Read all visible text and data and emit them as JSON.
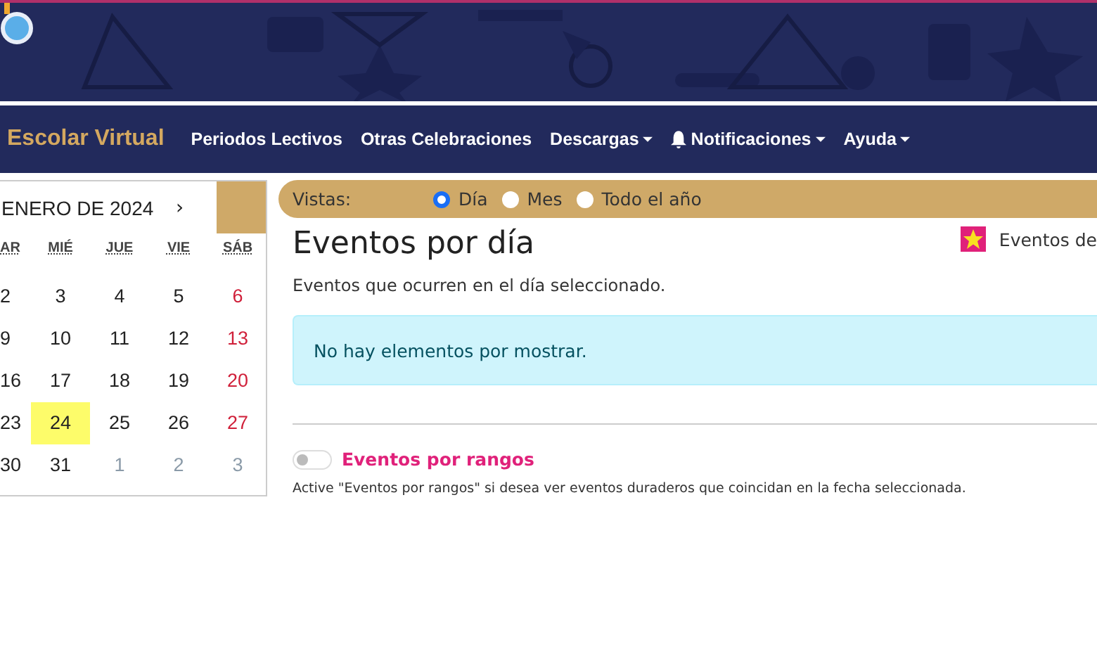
{
  "navbar": {
    "brand": "Escolar Virtual",
    "items": [
      {
        "label": "Periodos Lectivos",
        "dropdown": false,
        "bell": false
      },
      {
        "label": "Otras Celebraciones",
        "dropdown": false,
        "bell": false
      },
      {
        "label": "Descargas",
        "dropdown": true,
        "bell": false
      },
      {
        "label": "Notificaciones",
        "dropdown": true,
        "bell": true
      },
      {
        "label": "Ayuda",
        "dropdown": true,
        "bell": false
      }
    ]
  },
  "calendar": {
    "title": "ENERO DE 2024",
    "next": "›",
    "weekdays": [
      "AR",
      "MIÉ",
      "JUE",
      "VIE",
      "SÁB"
    ],
    "weeks": [
      [
        {
          "day": "2",
          "weekend": false,
          "other_month": false,
          "selected": false
        },
        {
          "day": "3",
          "weekend": false,
          "other_month": false,
          "selected": false
        },
        {
          "day": "4",
          "weekend": false,
          "other_month": false,
          "selected": false
        },
        {
          "day": "5",
          "weekend": false,
          "other_month": false,
          "selected": false
        },
        {
          "day": "6",
          "weekend": true,
          "other_month": false,
          "selected": false
        }
      ],
      [
        {
          "day": "9",
          "weekend": false,
          "other_month": false,
          "selected": false
        },
        {
          "day": "10",
          "weekend": false,
          "other_month": false,
          "selected": false
        },
        {
          "day": "11",
          "weekend": false,
          "other_month": false,
          "selected": false
        },
        {
          "day": "12",
          "weekend": false,
          "other_month": false,
          "selected": false
        },
        {
          "day": "13",
          "weekend": true,
          "other_month": false,
          "selected": false
        }
      ],
      [
        {
          "day": "16",
          "weekend": false,
          "other_month": false,
          "selected": false
        },
        {
          "day": "17",
          "weekend": false,
          "other_month": false,
          "selected": false
        },
        {
          "day": "18",
          "weekend": false,
          "other_month": false,
          "selected": false
        },
        {
          "day": "19",
          "weekend": false,
          "other_month": false,
          "selected": false
        },
        {
          "day": "20",
          "weekend": true,
          "other_month": false,
          "selected": false
        }
      ],
      [
        {
          "day": "23",
          "weekend": false,
          "other_month": false,
          "selected": false
        },
        {
          "day": "24",
          "weekend": false,
          "other_month": false,
          "selected": true
        },
        {
          "day": "25",
          "weekend": false,
          "other_month": false,
          "selected": false
        },
        {
          "day": "26",
          "weekend": false,
          "other_month": false,
          "selected": false
        },
        {
          "day": "27",
          "weekend": true,
          "other_month": false,
          "selected": false
        }
      ],
      [
        {
          "day": "30",
          "weekend": false,
          "other_month": false,
          "selected": false
        },
        {
          "day": "31",
          "weekend": false,
          "other_month": false,
          "selected": false
        },
        {
          "day": "1",
          "weekend": false,
          "other_month": true,
          "selected": false
        },
        {
          "day": "2",
          "weekend": false,
          "other_month": true,
          "selected": false
        },
        {
          "day": "3",
          "weekend": false,
          "other_month": true,
          "selected": false
        }
      ]
    ]
  },
  "views": {
    "label": "Vistas:",
    "options": [
      {
        "label": "Día",
        "selected": true
      },
      {
        "label": "Mes",
        "selected": false
      },
      {
        "label": "Todo el año",
        "selected": false
      }
    ]
  },
  "title": "Eventos por día",
  "legend": "Eventos de",
  "subtitle": "Eventos que ocurren en el día seleccionado.",
  "empty_message": "No hay elementos por mostrar.",
  "range_toggle": {
    "label": "Eventos por rangos",
    "on": false,
    "help": "Active \"Eventos por rangos\" si desea ver eventos duraderos que coincidan en la fecha seleccionada."
  }
}
